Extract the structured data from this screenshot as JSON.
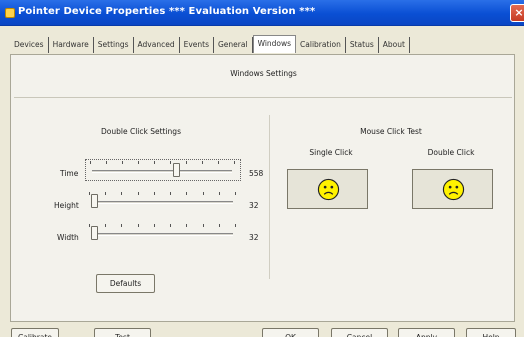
{
  "window": {
    "title": "Pointer Device Properties *** Evaluation Version ***",
    "close_glyph": "×",
    "accent": "#0a4fd4"
  },
  "tabs": [
    {
      "label": "Devices"
    },
    {
      "label": "Hardware"
    },
    {
      "label": "Settings"
    },
    {
      "label": "Advanced"
    },
    {
      "label": "Events"
    },
    {
      "label": "General"
    },
    {
      "label": "Windows",
      "active": true
    },
    {
      "label": "Calibration"
    },
    {
      "label": "Status"
    },
    {
      "label": "About"
    }
  ],
  "page": {
    "title": "Windows Settings",
    "double_click": {
      "title": "Double Click Settings",
      "sliders": [
        {
          "label": "Time",
          "value": "558",
          "position": 0.61
        },
        {
          "label": "Height",
          "value": "32",
          "position": 0.0
        },
        {
          "label": "Width",
          "value": "32",
          "position": 0.0
        }
      ],
      "defaults_label": "Defaults"
    },
    "mouse_test": {
      "title": "Mouse Click Test",
      "single_label": "Single Click",
      "double_label": "Double Click",
      "face_icon": "frown-face-icon",
      "face_color": "#fff200"
    }
  },
  "buttons": {
    "calibrate": "Calibrate",
    "test": "Test",
    "ok": "OK",
    "cancel": "Cancel",
    "apply": "Apply",
    "help": "Help"
  }
}
